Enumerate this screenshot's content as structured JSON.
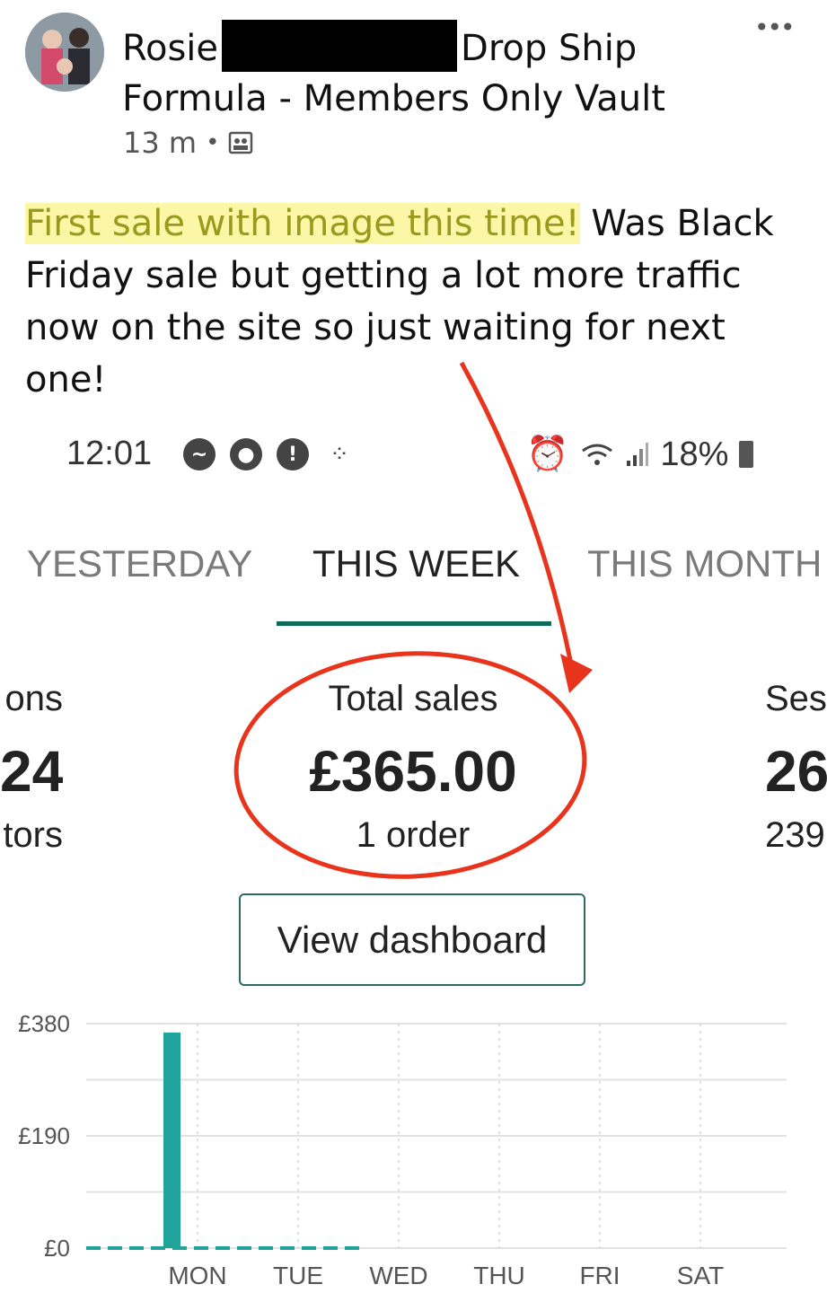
{
  "post": {
    "author_first": "Rosie",
    "author_rest": "Drop Ship Formula - Members Only Vault",
    "time": "13 m",
    "more": "•••",
    "highlight": "First sale with image this time!",
    "body": " Was Black Friday sale but getting a lot more traffic now on the site so just  waiting for next one!"
  },
  "phone": {
    "status_time": "12:01",
    "battery": "18%",
    "icons": [
      "messenger-icon",
      "balloon-icon",
      "alert-icon",
      "dots-icon",
      "alarm-icon",
      "wifi-icon",
      "signal-icon",
      "battery-icon"
    ]
  },
  "tabs": [
    {
      "label": "YESTERDAY"
    },
    {
      "label": "THIS WEEK",
      "active": true
    },
    {
      "label": "THIS MONTH"
    }
  ],
  "stats": {
    "left": {
      "label": "ons",
      "value": "24",
      "sub": "tors"
    },
    "center": {
      "label": "Total sales",
      "value": "£365.00",
      "sub": "1 order"
    },
    "right": {
      "label": "Ses",
      "value": "26",
      "sub": "239"
    }
  },
  "dashboard_button": "View dashboard",
  "colors": {
    "accent": "#0d6b57",
    "bar": "#1fa39a",
    "annotation": "#e8341c",
    "highlight": "#fbf7a6"
  },
  "chart_data": {
    "type": "bar",
    "categories": [
      "MON",
      "TUE",
      "WED",
      "THU",
      "FRI",
      "SAT"
    ],
    "values": [
      365,
      0,
      0,
      0,
      0,
      0
    ],
    "y_ticks": [
      "£380",
      "£190",
      "£0"
    ],
    "ylim": [
      0,
      380
    ],
    "grid": true
  }
}
